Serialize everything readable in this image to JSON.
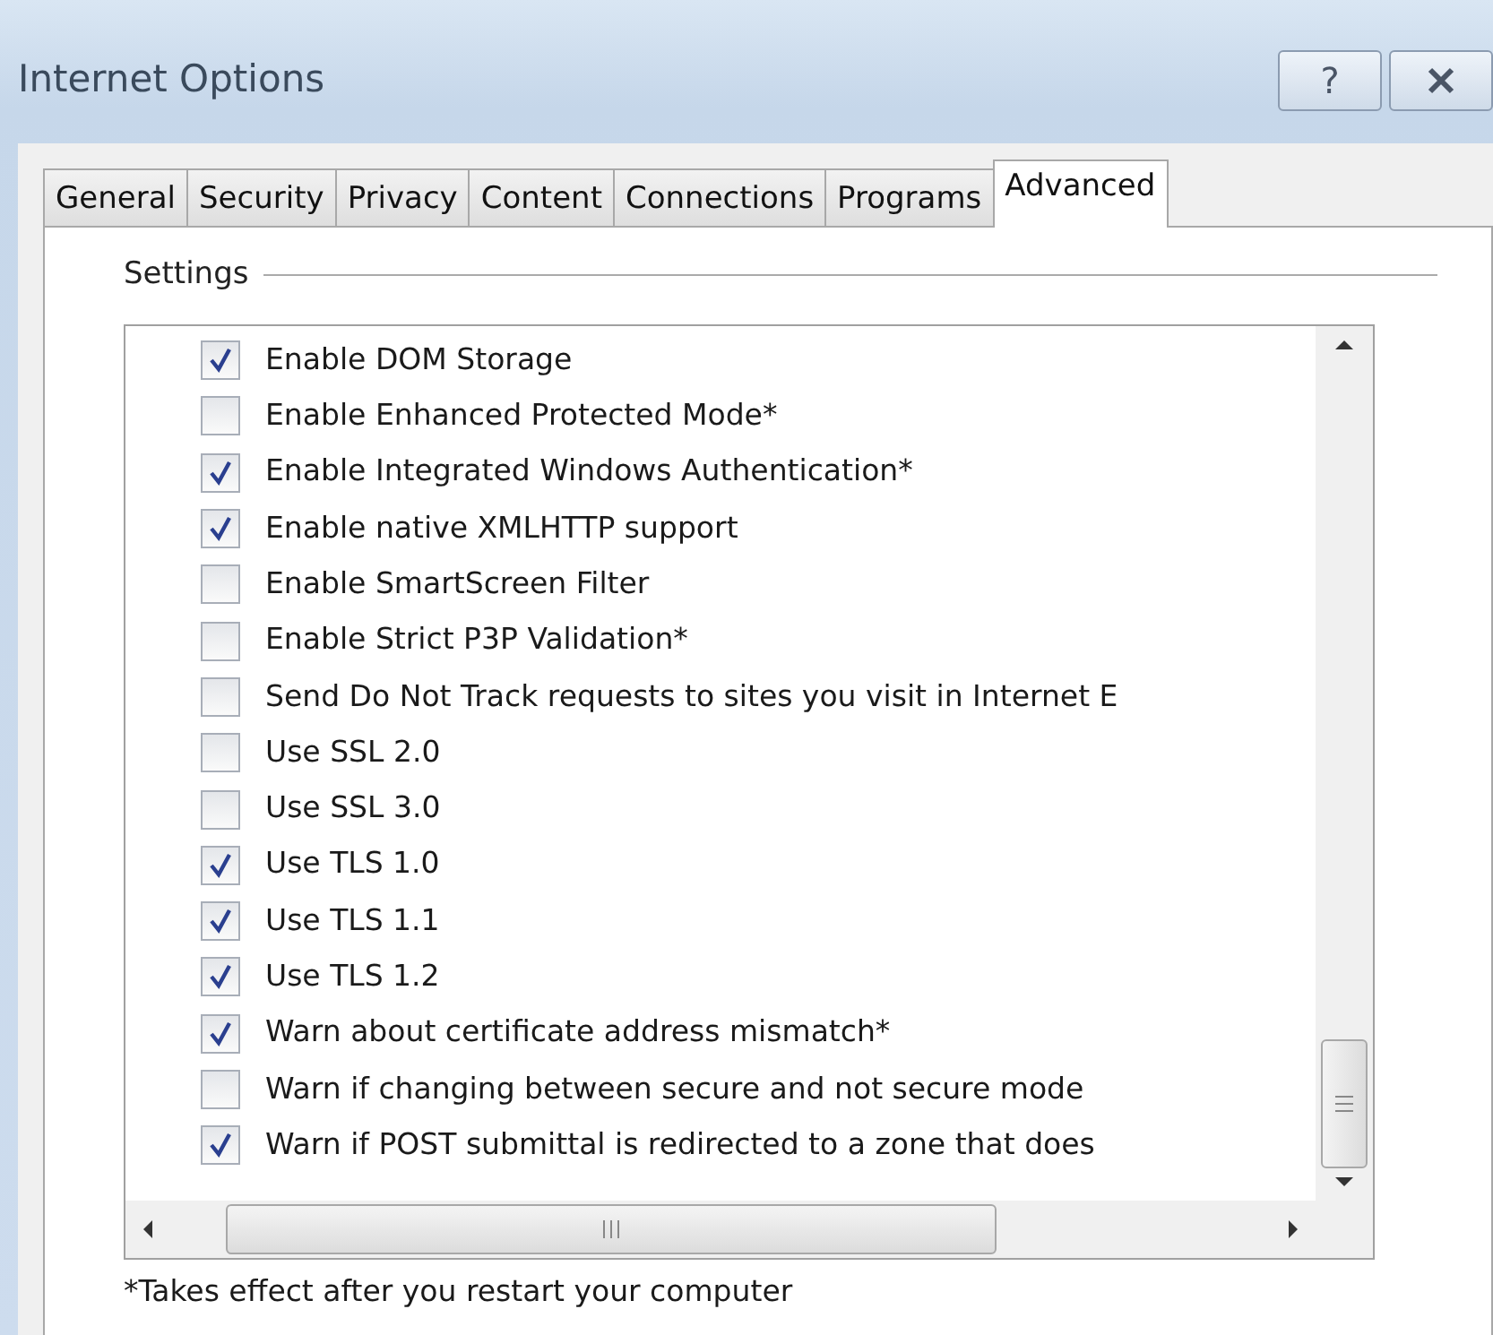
{
  "window": {
    "title": "Internet Options",
    "buttons": [
      {
        "kind": "help",
        "label": "?"
      },
      {
        "kind": "close"
      }
    ]
  },
  "tabs": [
    {
      "label": "General",
      "selected": false
    },
    {
      "label": "Security",
      "selected": false
    },
    {
      "label": "Privacy",
      "selected": false
    },
    {
      "label": "Content",
      "selected": false
    },
    {
      "label": "Connections",
      "selected": false
    },
    {
      "label": "Programs",
      "selected": false
    },
    {
      "label": "Advanced",
      "selected": true
    }
  ],
  "settings": {
    "title": "Settings",
    "items": [
      {
        "label": "Enable DOM Storage",
        "checked": true
      },
      {
        "label": "Enable Enhanced Protected Mode*",
        "checked": false
      },
      {
        "label": "Enable Integrated Windows Authentication*",
        "checked": true
      },
      {
        "label": "Enable native XMLHTTP support",
        "checked": true
      },
      {
        "label": "Enable SmartScreen Filter",
        "checked": false
      },
      {
        "label": "Enable Strict P3P Validation*",
        "checked": false
      },
      {
        "label": "Send Do Not Track requests to sites you visit in Internet E",
        "checked": false
      },
      {
        "label": "Use SSL 2.0",
        "checked": false
      },
      {
        "label": "Use SSL 3.0",
        "checked": false
      },
      {
        "label": "Use TLS 1.0",
        "checked": true
      },
      {
        "label": "Use TLS 1.1",
        "checked": true
      },
      {
        "label": "Use TLS 1.2",
        "checked": true
      },
      {
        "label": "Warn about certificate address mismatch*",
        "checked": true
      },
      {
        "label": "Warn if changing between secure and not secure mode",
        "checked": false
      },
      {
        "label": "Warn if POST submittal is redirected to a zone that does",
        "checked": true
      }
    ]
  },
  "footnote": "*Takes effect after you restart your computer"
}
